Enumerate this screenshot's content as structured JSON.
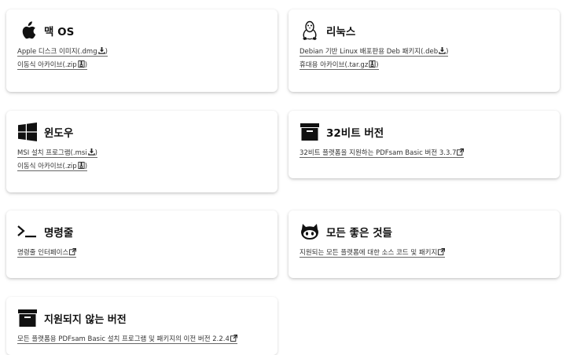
{
  "cards": {
    "mac": {
      "icon": "apple-icon",
      "title": "맥 OS",
      "links": [
        {
          "label": "Apple 디스크 이미지(.dmg",
          "suffix": ")",
          "icon": "download-icon"
        },
        {
          "label": "이동식 아카이브(.zip",
          "suffix": ")",
          "icon": "archive-file-icon"
        }
      ]
    },
    "linux": {
      "icon": "linux-penguin-icon",
      "title": "리눅스",
      "links": [
        {
          "label": "Debian 기반 Linux 배포판용 Deb 패키지(.deb",
          "suffix": ")",
          "icon": "download-icon"
        },
        {
          "label": "휴대용 아카이브(.tar.gz",
          "suffix": ")",
          "icon": "archive-file-icon"
        }
      ]
    },
    "windows": {
      "icon": "windows-icon",
      "title": "윈도우",
      "links": [
        {
          "label": "MSI 설치 프로그램(.msi",
          "suffix": ")",
          "icon": "download-icon"
        },
        {
          "label": "이동식 아카이브(.zip",
          "suffix": ")",
          "icon": "archive-file-icon"
        }
      ]
    },
    "bit32": {
      "icon": "archive-box-icon",
      "title": "32비트 버전",
      "links": [
        {
          "label": "32비트 플랫폼을 지원하는 PDFsam Basic 버전 3.3.7",
          "suffix": "",
          "icon": "external-link-icon"
        }
      ]
    },
    "cli": {
      "icon": "terminal-icon",
      "title": "명령줄",
      "links": [
        {
          "label": "명령줄 인터페이스",
          "suffix": "",
          "icon": "external-link-icon"
        }
      ]
    },
    "all": {
      "icon": "github-icon",
      "title": "모든 좋은 것들",
      "links": [
        {
          "label": "지원되는 모든 플랫폼에 대한 소스 코드 및 패키지",
          "suffix": "",
          "icon": "external-link-icon"
        }
      ]
    },
    "unsupported": {
      "icon": "archive-box-icon",
      "title": "지원되지 않는 버전",
      "links": [
        {
          "label": "모든 플랫폼용 PDFsam Basic 설치 프로그램 및 패키지의 이전 버전 2.2.4",
          "suffix": "",
          "icon": "external-link-icon"
        }
      ]
    }
  }
}
